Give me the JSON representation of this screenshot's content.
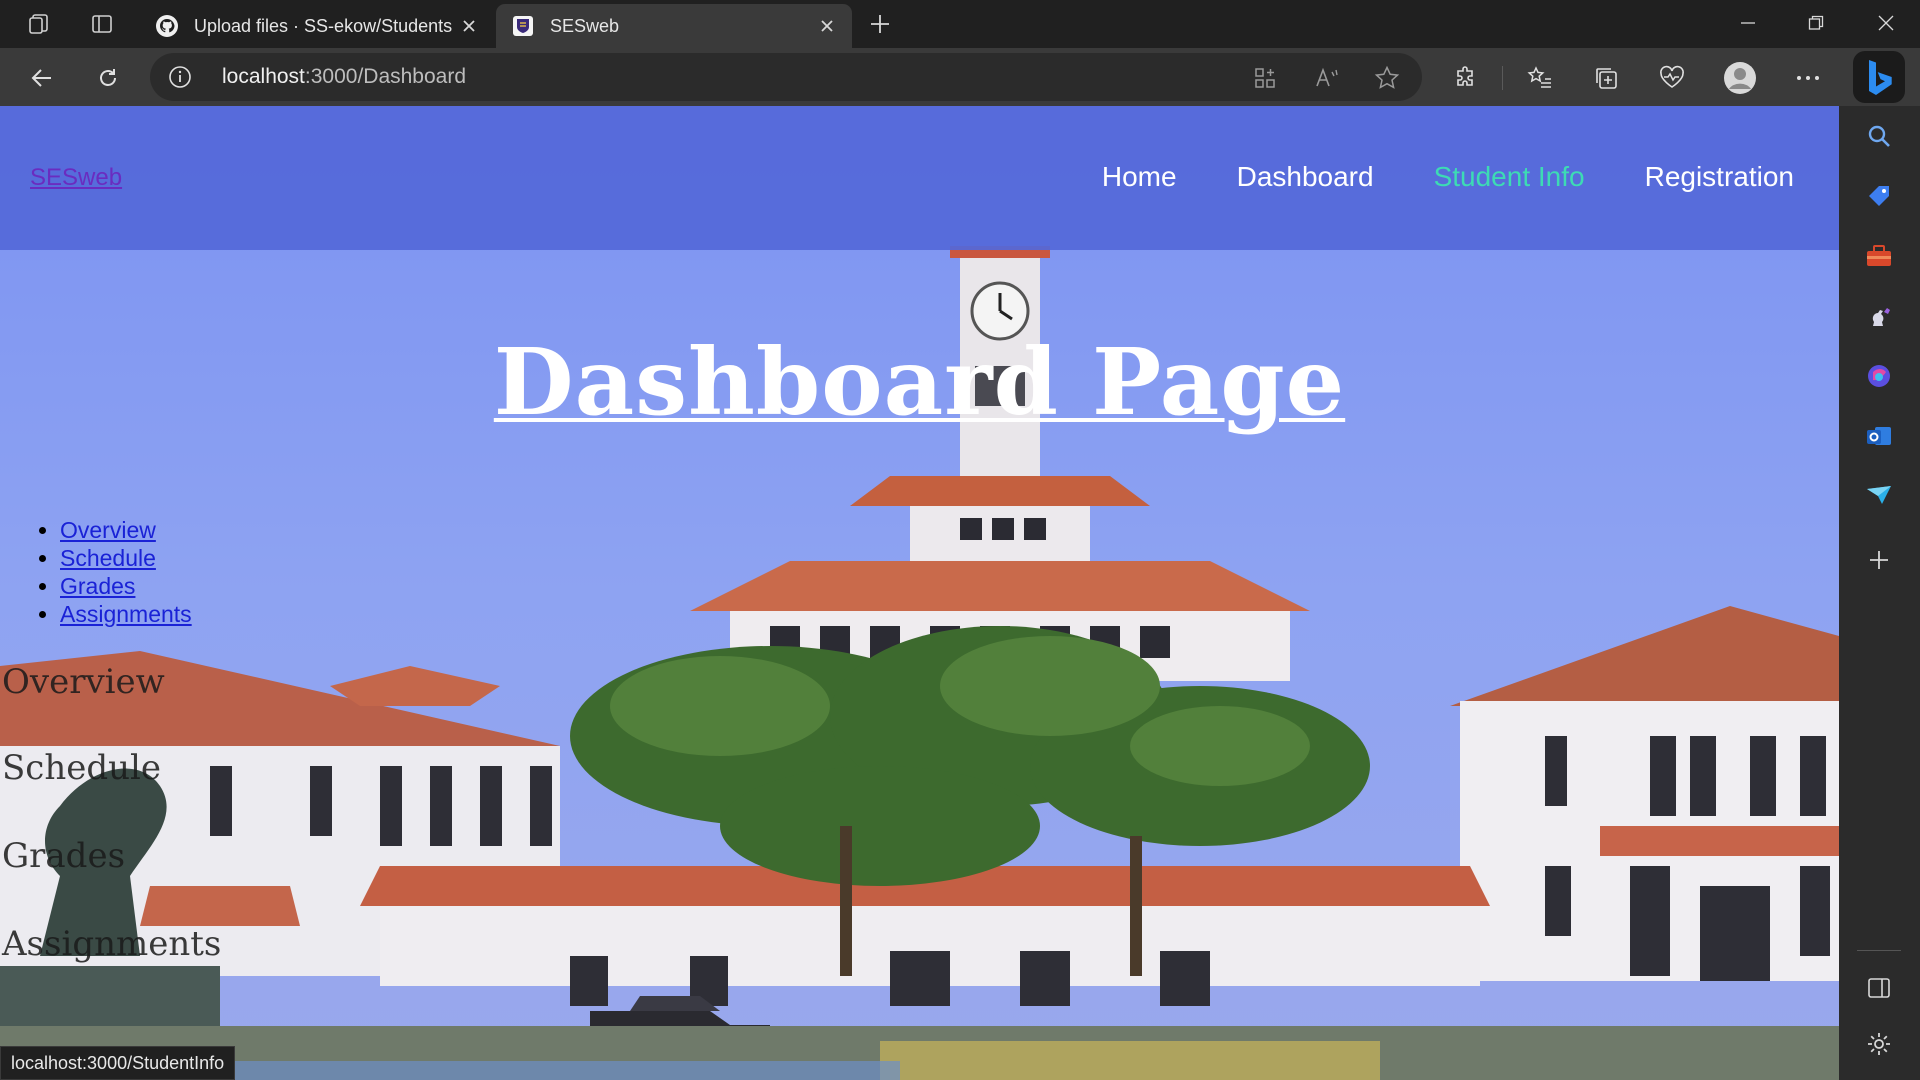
{
  "browser": {
    "tabs": [
      {
        "title": "Upload files · SS-ekow/Students-",
        "favicon": "github-icon"
      },
      {
        "title": "SESweb",
        "favicon": "site-crest-icon"
      }
    ],
    "address": {
      "host": "localhost",
      "path": ":3000/Dashboard"
    },
    "status_url": "localhost:3000/StudentInfo"
  },
  "site": {
    "brand": "SESweb",
    "nav": [
      {
        "label": "Home",
        "active": false
      },
      {
        "label": "Dashboard",
        "active": false
      },
      {
        "label": "Student Info",
        "active": true
      },
      {
        "label": "Registration",
        "active": false
      }
    ],
    "page_title": "Dashboard Page",
    "sub_links": [
      "Overview",
      "Schedule",
      "Grades",
      "Assignments"
    ],
    "sections": [
      "Overview",
      "Schedule",
      "Grades",
      "Assignments"
    ]
  },
  "colors": {
    "navbar": "#5468d9",
    "active_link": "#3ddbb4",
    "brand_link": "#6a2cc0"
  }
}
